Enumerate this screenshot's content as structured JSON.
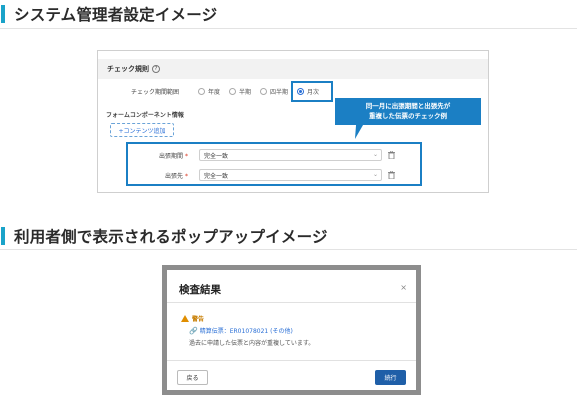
{
  "headings": {
    "admin": "システム管理者設定イメージ",
    "popup": "利用者側で表示されるポップアップイメージ"
  },
  "settings": {
    "panel_title": "チェック規則",
    "period_label": "チェック期間範囲",
    "period_options": [
      "年度",
      "半期",
      "四半期",
      "月次"
    ],
    "selected_period": "月次",
    "component_label": "フォームコンポーネント情報",
    "add_content": "+コンテンツ追加",
    "callout_line1": "同一月に出張期間と出張先が",
    "callout_line2": "重複した伝票のチェック例",
    "fields": [
      {
        "label": "出張期間",
        "value": "完全一致"
      },
      {
        "label": "出張先",
        "value": "完全一致"
      }
    ]
  },
  "popup": {
    "title": "検査結果",
    "close": "×",
    "warning_label": "警告",
    "link_text": "精算伝票：ER01078021 (その他)",
    "message": "過去に申請した伝票と内容が重複しています。",
    "back_button": "戻る",
    "continue_button": "続行"
  },
  "colors": {
    "accent": "#1aa3c9",
    "highlight_blue": "#1b7fc4",
    "primary_button": "#1f5fa8",
    "warning": "#e08e00",
    "required": "#d9301b"
  }
}
